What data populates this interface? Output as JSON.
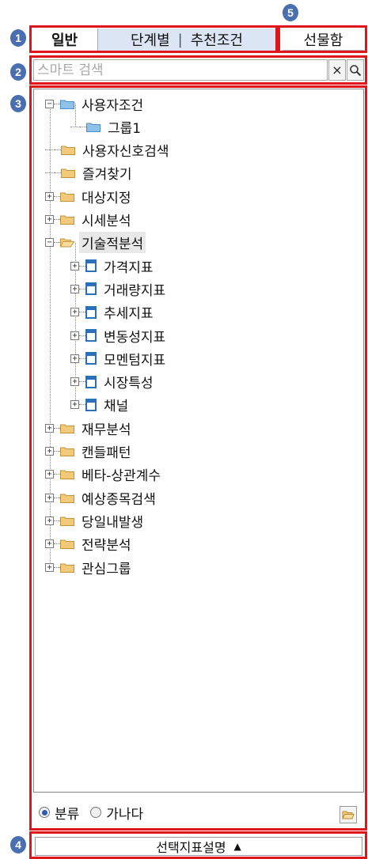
{
  "badges": [
    "1",
    "2",
    "3",
    "4",
    "5"
  ],
  "tabs": {
    "active": "일반",
    "group_a": "단계별",
    "separator": "|",
    "group_b": "추천조건",
    "futures": "선물함"
  },
  "search": {
    "placeholder": "스마트 검색",
    "clear_icon": "×",
    "search_icon": "magnifier-icon"
  },
  "tree": [
    {
      "label": "사용자조건",
      "level": 0,
      "icon": "folder-blue",
      "expander": "minus"
    },
    {
      "label": "그룹1",
      "level": 1,
      "icon": "folder-blue",
      "expander": "none"
    },
    {
      "label": "사용자신호검색",
      "level": 0,
      "icon": "folder",
      "expander": "none"
    },
    {
      "label": "즐겨찾기",
      "level": 0,
      "icon": "folder",
      "expander": "none"
    },
    {
      "label": "대상지정",
      "level": 0,
      "icon": "folder",
      "expander": "plus"
    },
    {
      "label": "시세분석",
      "level": 0,
      "icon": "folder",
      "expander": "plus"
    },
    {
      "label": "기술적분석",
      "level": 0,
      "icon": "folder-open",
      "expander": "minus",
      "selected": true
    },
    {
      "label": "가격지표",
      "level": 1,
      "icon": "doc",
      "expander": "plus"
    },
    {
      "label": "거래량지표",
      "level": 1,
      "icon": "doc",
      "expander": "plus"
    },
    {
      "label": "추세지표",
      "level": 1,
      "icon": "doc",
      "expander": "plus"
    },
    {
      "label": "변동성지표",
      "level": 1,
      "icon": "doc",
      "expander": "plus"
    },
    {
      "label": "모멘텀지표",
      "level": 1,
      "icon": "doc",
      "expander": "plus"
    },
    {
      "label": "시장특성",
      "level": 1,
      "icon": "doc",
      "expander": "plus"
    },
    {
      "label": "채널",
      "level": 1,
      "icon": "doc",
      "expander": "plus"
    },
    {
      "label": "재무분석",
      "level": 0,
      "icon": "folder",
      "expander": "plus"
    },
    {
      "label": "캔들패턴",
      "level": 0,
      "icon": "folder",
      "expander": "plus"
    },
    {
      "label": "베타-상관계수",
      "level": 0,
      "icon": "folder",
      "expander": "plus"
    },
    {
      "label": "예상종목검색",
      "level": 0,
      "icon": "folder",
      "expander": "plus"
    },
    {
      "label": "당일내발생",
      "level": 0,
      "icon": "folder",
      "expander": "plus"
    },
    {
      "label": "전략분석",
      "level": 0,
      "icon": "folder",
      "expander": "plus"
    },
    {
      "label": "관심그룹",
      "level": 0,
      "icon": "folder",
      "expander": "plus"
    }
  ],
  "sort": {
    "option_category": "분류",
    "option_alpha": "가나다",
    "selected": "분류"
  },
  "description_bar": {
    "label": "선택지표설명",
    "arrow": "▲"
  },
  "colors": {
    "annotation_red": "#e0141b",
    "badge_blue": "#4a6fb0",
    "tab_bg": "#dbe5f4",
    "folder_tan": "#f3c97a",
    "folder_blue": "#8fc1ea",
    "doc_blue": "#2a70b8"
  }
}
